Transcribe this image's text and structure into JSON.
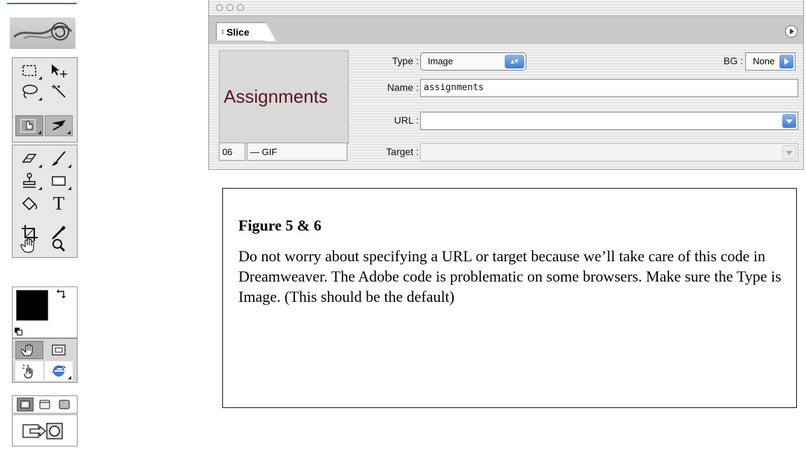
{
  "slice_palette": {
    "tab_label": "Slice",
    "tab_arrows": "↕",
    "preview_text": "Assignments",
    "slice_number": "06",
    "slice_format": "— GIF",
    "type_label": "Type :",
    "type_value": "Image",
    "type_stepper": "▴▾",
    "bg_label": "BG :",
    "bg_value": "None",
    "name_label": "Name :",
    "name_value": "assignments",
    "url_label": "URL :",
    "url_value": "",
    "target_label": "Target :",
    "target_value": ""
  },
  "toolbox": {
    "text_tool_glyph": "T"
  },
  "caption": {
    "title": "Figure 5 & 6",
    "body": "Do not worry about specifying a URL or target because we’ll take care of this code in Dreamweaver. The Adobe code is problematic on some browsers. Make sure the Type is Image. (This should be the default)"
  },
  "icons": [
    "marquee-icon",
    "move-icon",
    "lasso-icon",
    "magic-wand-icon",
    "slice-select-icon",
    "slice-icon",
    "eraser-icon",
    "brush-icon",
    "stamp-icon",
    "rectangle-icon",
    "paint-bucket-icon",
    "text-icon",
    "crop-icon",
    "eyedropper-icon",
    "hand-icon",
    "zoom-icon",
    "swap-colors-icon",
    "rollover-icon",
    "image-map-icon",
    "hand-cursor-icon",
    "browser-icon",
    "screen-mode-icon",
    "jump-to-photoshop-icon"
  ],
  "colors": {
    "preview_text": "#5a1420",
    "accent_blue": "#3d7bd2"
  }
}
